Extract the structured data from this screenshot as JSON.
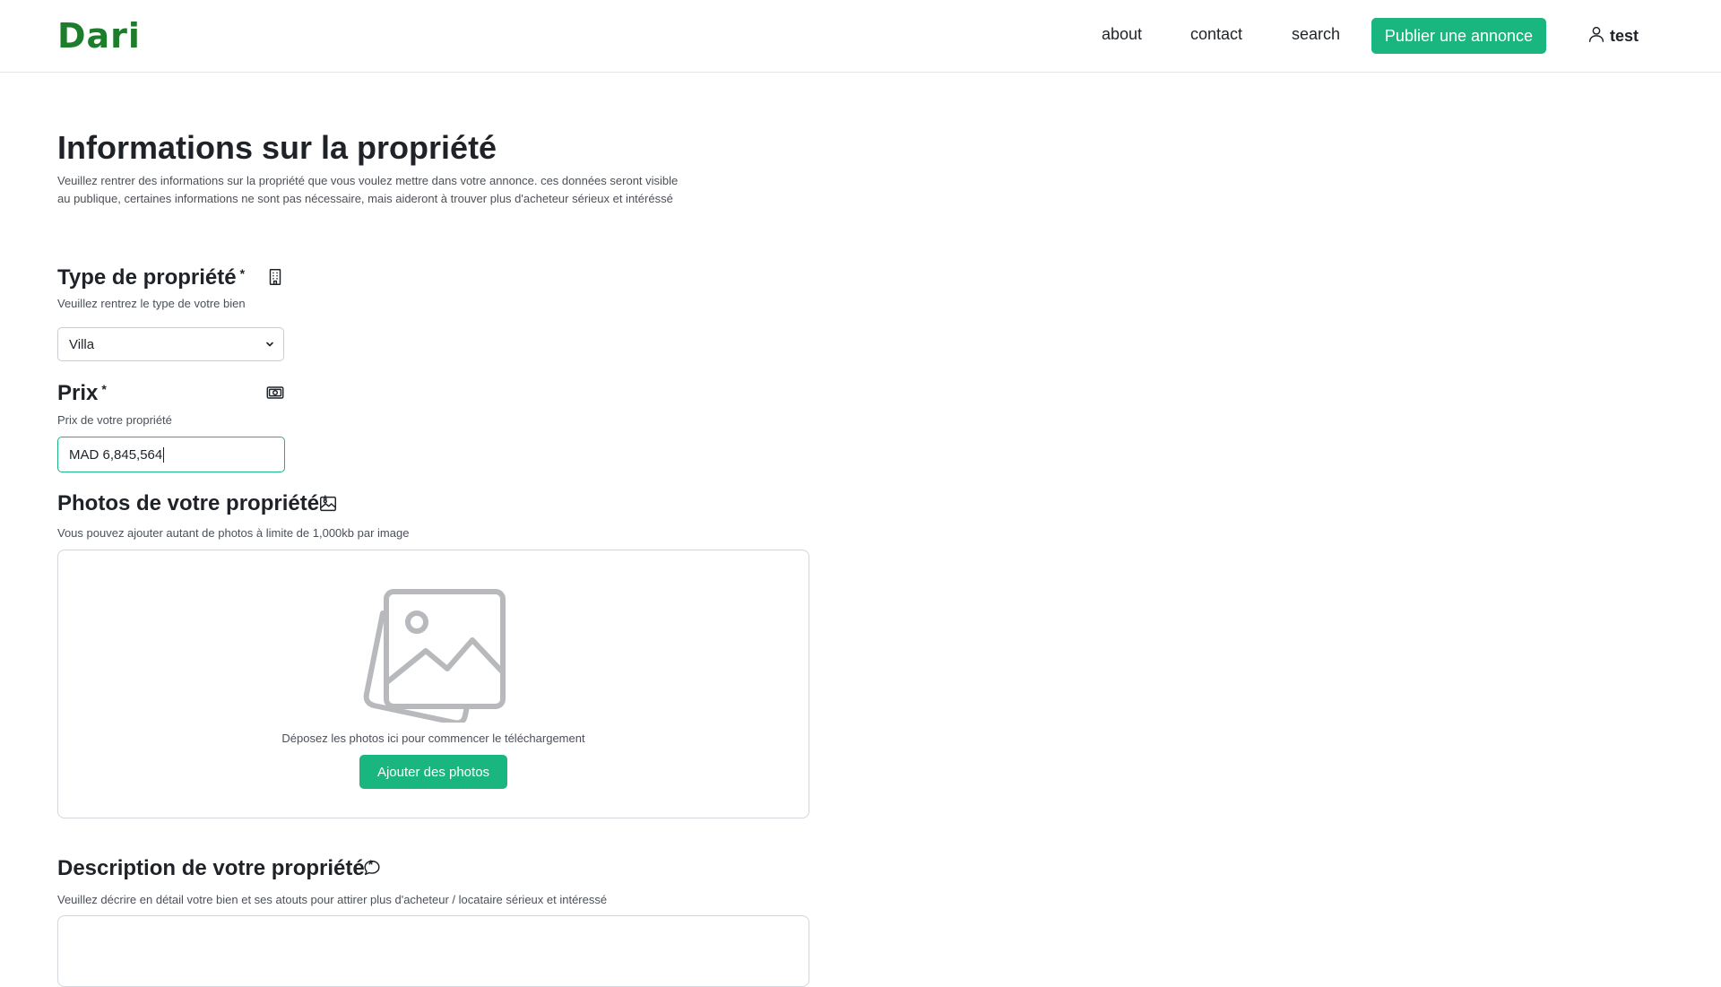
{
  "header": {
    "logo": "Dari",
    "nav": {
      "about": "about",
      "contact": "contact",
      "search": "search"
    },
    "publish_label": "Publier une annonce",
    "user_name": "test"
  },
  "page": {
    "title": "Informations sur la propriété",
    "description": "Veuillez rentrer des informations sur la propriété que vous voulez mettre dans votre annonce. ces données seront visible au publique, certaines informations ne sont pas nécessaire, mais aideront à trouver plus d'acheteur sérieux et intéréssé"
  },
  "type_field": {
    "label": "Type de propriété",
    "required_mark": "*",
    "help": "Veuillez rentrez le type de votre bien",
    "selected": "Villa",
    "icon": "building-icon"
  },
  "price_field": {
    "label": "Prix",
    "required_mark": "*",
    "help": "Prix de votre propriété",
    "value": "MAD 6,845,564",
    "icon": "money-icon"
  },
  "photos_field": {
    "label": "Photos de votre propriété",
    "required_mark": "*",
    "help": "Vous pouvez ajouter autant de photos à limite de 1,000kb par image",
    "drop_text": "Déposez les photos ici pour commencer le téléchargement",
    "button_label": "Ajouter des photos",
    "icon": "image-icon"
  },
  "description_field": {
    "label": "Description de votre propriété",
    "required_mark": "*",
    "help": "Veuillez décrire en détail votre bien et ses atouts pour attirer plus d'acheteur / locataire sérieux et intéressé",
    "value": "",
    "icon": "chat-bubble-icon"
  },
  "colors": {
    "brand_green": "#1e7d2c",
    "accent": "#1ab67f"
  }
}
